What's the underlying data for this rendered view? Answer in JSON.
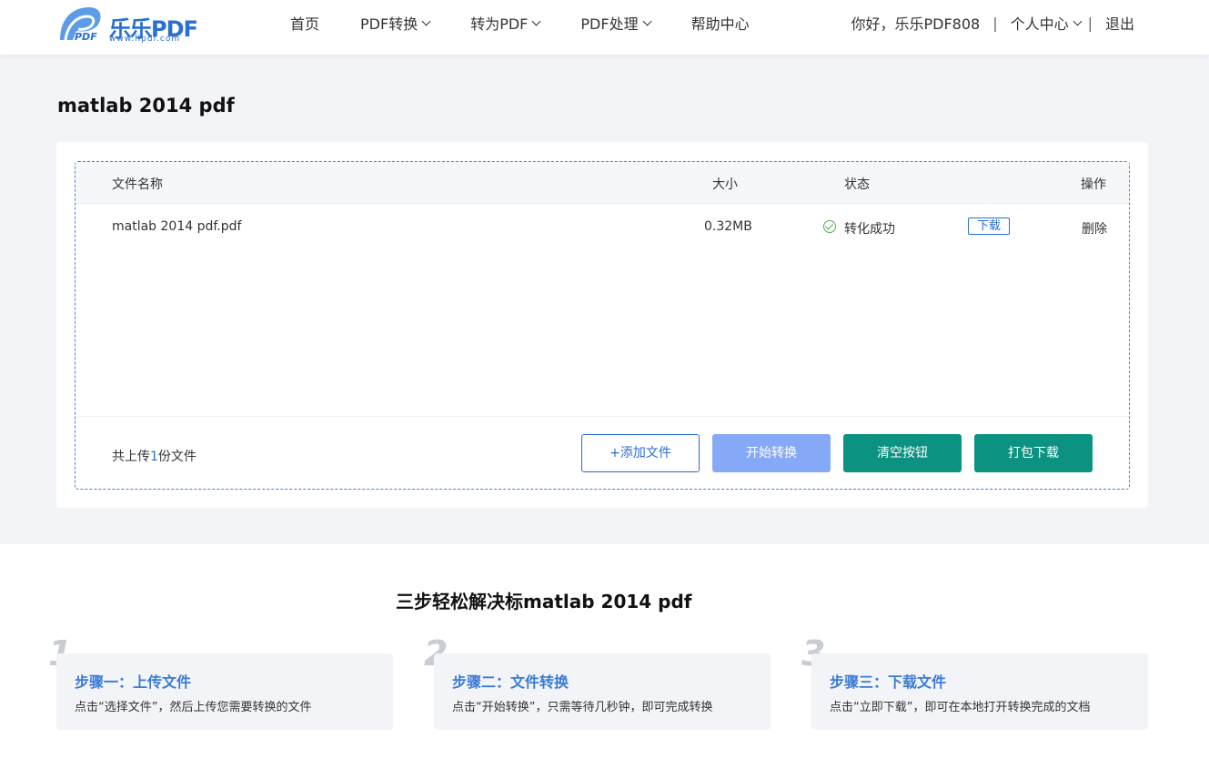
{
  "header": {
    "logo_text": "乐乐PDF",
    "logo_url": "www.llpdf.com",
    "nav": [
      {
        "label": "首页"
      },
      {
        "label": "PDF转换"
      },
      {
        "label": "转为PDF"
      },
      {
        "label": "PDF处理"
      },
      {
        "label": "帮助中心"
      }
    ],
    "greeting": "你好，乐乐PDF808",
    "user_center": "个人中心",
    "logout": "退出"
  },
  "main": {
    "title": "matlab 2014 pdf",
    "table": {
      "headers": {
        "name": "文件名称",
        "size": "大小",
        "status": "状态",
        "action": "操作"
      },
      "rows": [
        {
          "name": "matlab 2014 pdf.pdf",
          "size": "0.32MB",
          "status": "转化成功",
          "download": "下载",
          "delete": "删除"
        }
      ]
    },
    "count_prefix": "共上传",
    "count_value": "1",
    "count_suffix": "份文件",
    "buttons": {
      "add": "+添加文件",
      "start": "开始转换",
      "clear": "清空按钮",
      "pack": "打包下载"
    }
  },
  "steps": {
    "title": "三步轻松解决标matlab 2014 pdf",
    "items": [
      {
        "num": "1",
        "heading": "步骤一：上传文件",
        "text": "点击“选择文件”，然后上传您需要转换的文件"
      },
      {
        "num": "2",
        "heading": "步骤二：文件转换",
        "text": "点击“开始转换”，只需等待几秒钟，即可完成转换"
      },
      {
        "num": "3",
        "heading": "步骤三：下载文件",
        "text": "点击“立即下载”，即可在本地打开转换完成的文档"
      }
    ]
  },
  "colors": {
    "brand_blue": "#2a6fd1",
    "teal": "#0b9280",
    "start_disabled": "#86a9f7",
    "success": "#4caf50"
  }
}
